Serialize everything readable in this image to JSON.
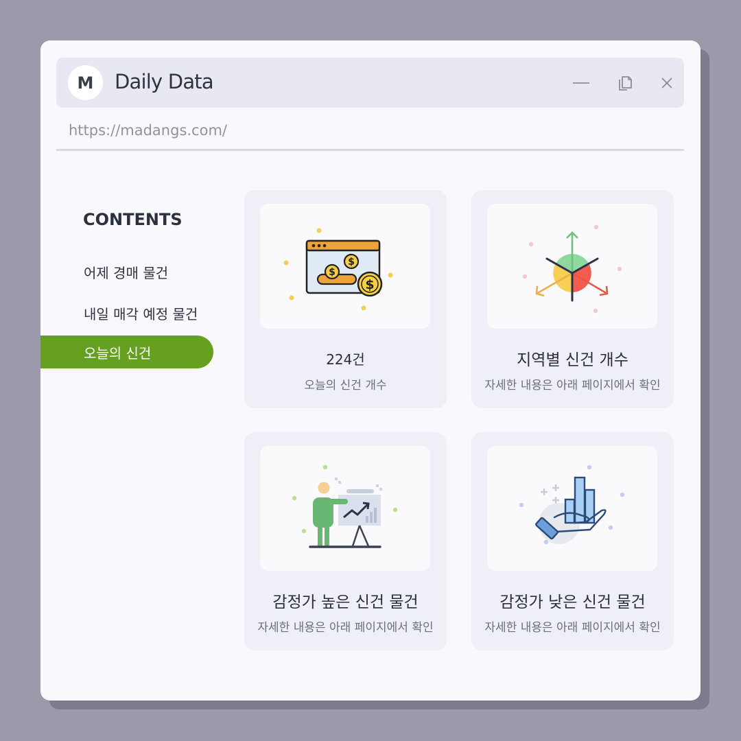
{
  "window": {
    "avatar_letter": "M",
    "title": "Daily Data",
    "url": "https://madangs.com/"
  },
  "sidebar": {
    "heading": "CONTENTS",
    "items": [
      {
        "label": "어제 경매 물건",
        "active": false
      },
      {
        "label": "내일 매각 예정 물건",
        "active": false
      },
      {
        "label": "오늘의 신건",
        "active": true
      }
    ]
  },
  "cards": [
    {
      "title": "224건",
      "subtitle": "오늘의 신건 개수",
      "icon": "money-browser-icon"
    },
    {
      "title": "지역별 신건 개수",
      "subtitle": "자세한 내용은 아래 페이지에서 확인",
      "icon": "region-arrows-icon"
    },
    {
      "title": "감정가 높은 신건 물건",
      "subtitle": "자세한 내용은 아래 페이지에서 확인",
      "icon": "presentation-chart-icon"
    },
    {
      "title": "감정가 낮은 신건 물건",
      "subtitle": "자세한 내용은 아래 페이지에서 확인",
      "icon": "hand-bar-chart-icon"
    }
  ],
  "colors": {
    "accent": "#66a020",
    "background": "#9a9aab",
    "window": "#f8f8fd",
    "card": "#eeeff7"
  }
}
